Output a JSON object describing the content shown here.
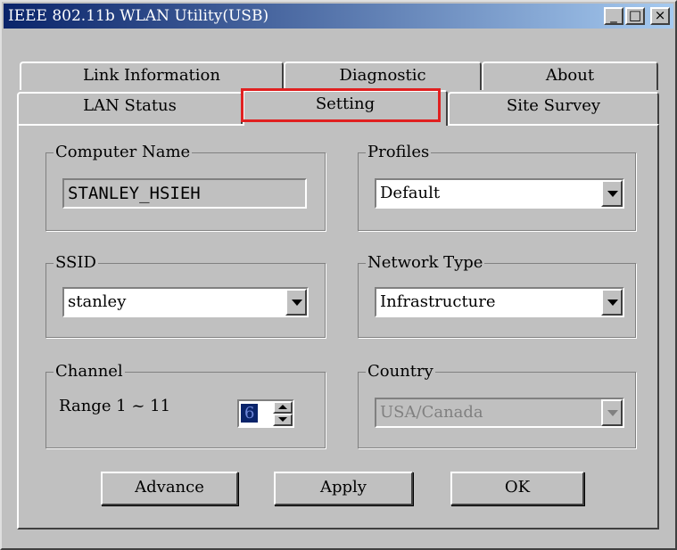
{
  "window": {
    "title": "IEEE 802.11b WLAN Utility(USB)"
  },
  "title_buttons": {
    "minimize": "_",
    "maximize": "□",
    "close": "×"
  },
  "tabs": {
    "row_back": [
      {
        "label": "Link Information"
      },
      {
        "label": "Diagnostic"
      },
      {
        "label": "About"
      }
    ],
    "row_front": [
      {
        "label": "LAN Status"
      },
      {
        "label": "Setting",
        "selected": true
      },
      {
        "label": "Site Survey"
      }
    ],
    "highlight_color": "#e02020"
  },
  "computer_name": {
    "label": "Computer Name",
    "value": "STANLEY_HSIEH"
  },
  "profiles": {
    "label": "Profiles",
    "value": "Default"
  },
  "ssid": {
    "label": "SSID",
    "value": "stanley"
  },
  "network_type": {
    "label": "Network Type",
    "value": "Infrastructure"
  },
  "channel": {
    "label": "Channel",
    "range_text": "Range 1 ~ 11",
    "value": "6"
  },
  "country": {
    "label": "Country",
    "value": "USA/Canada",
    "enabled": false
  },
  "buttons": {
    "advance": "Advance",
    "apply": "Apply",
    "ok": "OK"
  },
  "colors": {
    "titlebar_start": "#0a246a",
    "titlebar_end": "#a6caf0",
    "face": "#c0c0c0",
    "selection": "#0a246a"
  }
}
